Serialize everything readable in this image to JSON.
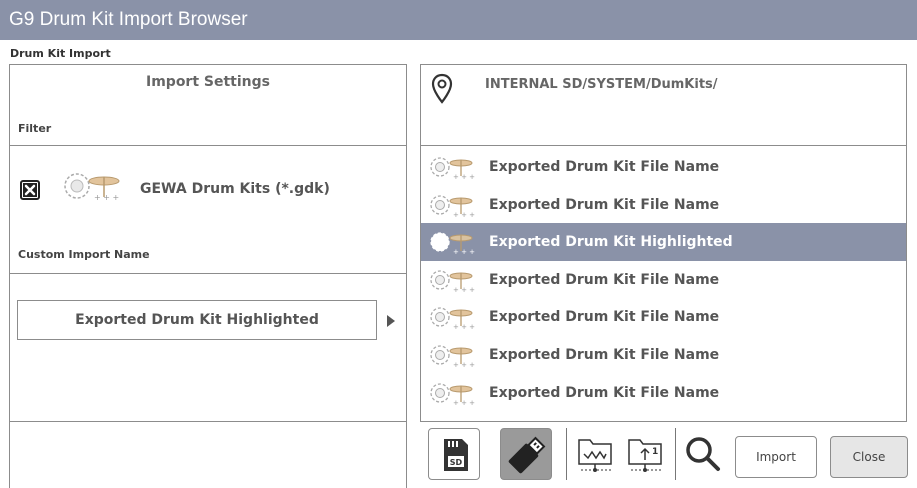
{
  "window": {
    "title": "G9 Drum Kit Import Browser"
  },
  "section_label": "Drum Kit Import",
  "import_settings": {
    "title": "Import Settings",
    "filter_label": "Filter",
    "filter": {
      "checked": true,
      "text": "GEWA Drum Kits (*.gdk)",
      "icon": "drum-kit-icon"
    },
    "custom_name_label": "Custom Import Name",
    "custom_name_value": "Exported Drum Kit Highlighted"
  },
  "path": {
    "icon": "location-pin-icon",
    "text": "INTERNAL SD/SYSTEM/DumKits/"
  },
  "file_list": {
    "items": [
      {
        "label": "Exported Drum Kit File Name",
        "selected": false
      },
      {
        "label": "Exported Drum Kit File Name",
        "selected": false
      },
      {
        "label": "Exported Drum Kit Highlighted",
        "selected": true
      },
      {
        "label": "Exported Drum Kit File Name",
        "selected": false
      },
      {
        "label": "Exported Drum Kit File Name",
        "selected": false
      },
      {
        "label": "Exported Drum Kit File Name",
        "selected": false
      },
      {
        "label": "Exported Drum Kit File Name",
        "selected": false
      }
    ]
  },
  "toolbar": {
    "sd_label": "SD",
    "sd_icon": "sd-card-icon",
    "usb_icon": "usb-stick-icon",
    "folder_home_icon": "folder-root-icon",
    "folder_up_icon": "folder-up-icon",
    "folder_up_badge": "1",
    "search_icon": "search-icon",
    "import_label": "Import",
    "close_label": "Close"
  },
  "colors": {
    "title_bar": "#8a92a8",
    "selection": "#8a92a8",
    "border": "#8c8c8c",
    "text": "#555555"
  }
}
